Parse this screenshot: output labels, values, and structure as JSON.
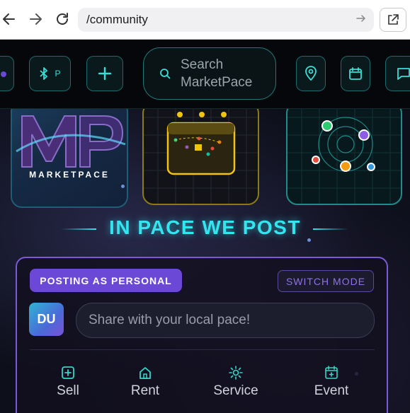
{
  "browser": {
    "url": "/community",
    "back_icon": "arrow-left-icon",
    "forward_icon": "arrow-right-icon",
    "reload_icon": "reload-icon",
    "go_icon": "arrow-right-icon",
    "external_icon": "open-external-icon"
  },
  "header": {
    "bluetooth_badge_text": "P",
    "search_placeholder": "Search MarketPace",
    "icons": [
      "bluetooth-icon",
      "plus-icon",
      "location-pin-icon",
      "calendar-icon",
      "chat-icon"
    ],
    "accent_color": "#36e0d8"
  },
  "tiles": {
    "logo_word": "MARKETPACE"
  },
  "headline": "IN PACE WE POST",
  "composer": {
    "mode_badge": "POSTING AS PERSONAL",
    "switch_mode": "SWITCH MODE",
    "avatar_initials": "DU",
    "input_placeholder": "Share with your local pace!",
    "actions": [
      {
        "label": "Sell",
        "icon": "plus-square-icon"
      },
      {
        "label": "Rent",
        "icon": "house-icon"
      },
      {
        "label": "Service",
        "icon": "gear-sun-icon"
      },
      {
        "label": "Event",
        "icon": "calendar-plus-icon"
      }
    ],
    "border_color": "#7a5ad8",
    "badge_color": "#6b48d6"
  }
}
